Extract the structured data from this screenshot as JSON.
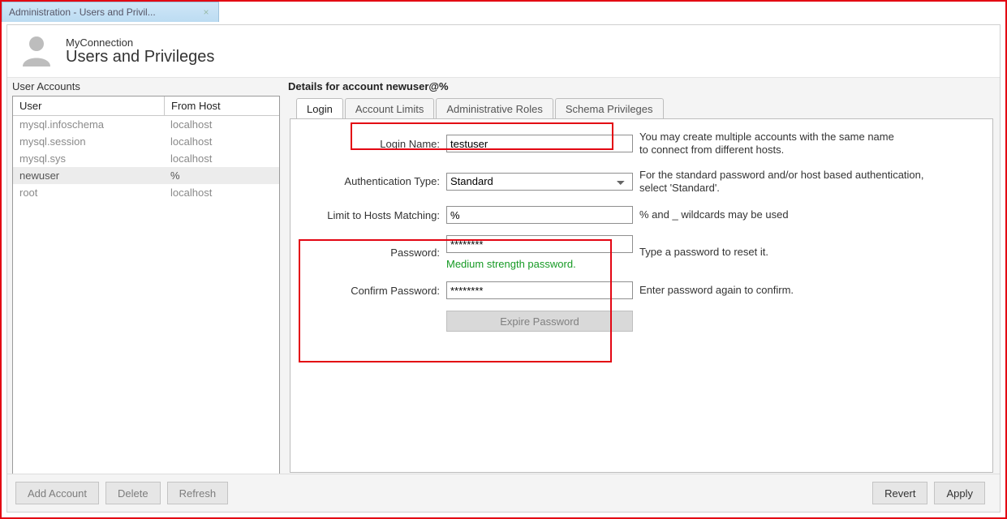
{
  "doctab": {
    "title": "Administration - Users and Privil..."
  },
  "header": {
    "connection": "MyConnection",
    "title": "Users and Privileges"
  },
  "left": {
    "heading": "User Accounts",
    "columns": {
      "user": "User",
      "host": "From Host"
    },
    "rows": [
      {
        "user": "mysql.infoschema",
        "host": "localhost",
        "selected": false
      },
      {
        "user": "mysql.session",
        "host": "localhost",
        "selected": false
      },
      {
        "user": "mysql.sys",
        "host": "localhost",
        "selected": false
      },
      {
        "user": "newuser",
        "host": "%",
        "selected": true
      },
      {
        "user": "root",
        "host": "localhost",
        "selected": false
      }
    ],
    "buttons": {
      "add": "Add Account",
      "delete": "Delete",
      "refresh": "Refresh"
    }
  },
  "right": {
    "title": "Details for account newuser@%",
    "tabs": [
      "Login",
      "Account Limits",
      "Administrative Roles",
      "Schema Privileges"
    ],
    "activeTab": 0,
    "form": {
      "login_name": {
        "label": "Login Name:",
        "value": "testuser",
        "hint": "You may create multiple accounts with the same name\nto connect from different hosts."
      },
      "auth_type": {
        "label": "Authentication Type:",
        "value": "Standard",
        "hint": "For the standard password and/or host based authentication,\nselect 'Standard'."
      },
      "hosts": {
        "label": "Limit to Hosts Matching:",
        "value": "%",
        "hint": "% and _ wildcards may be used"
      },
      "password": {
        "label": "Password:",
        "value": "********",
        "hint": "Type a password to reset it."
      },
      "strength": "Medium strength password.",
      "confirm_password": {
        "label": "Confirm Password:",
        "value": "********",
        "hint": "Enter password again to confirm."
      },
      "expire": "Expire Password"
    },
    "buttons": {
      "revert": "Revert",
      "apply": "Apply"
    }
  }
}
